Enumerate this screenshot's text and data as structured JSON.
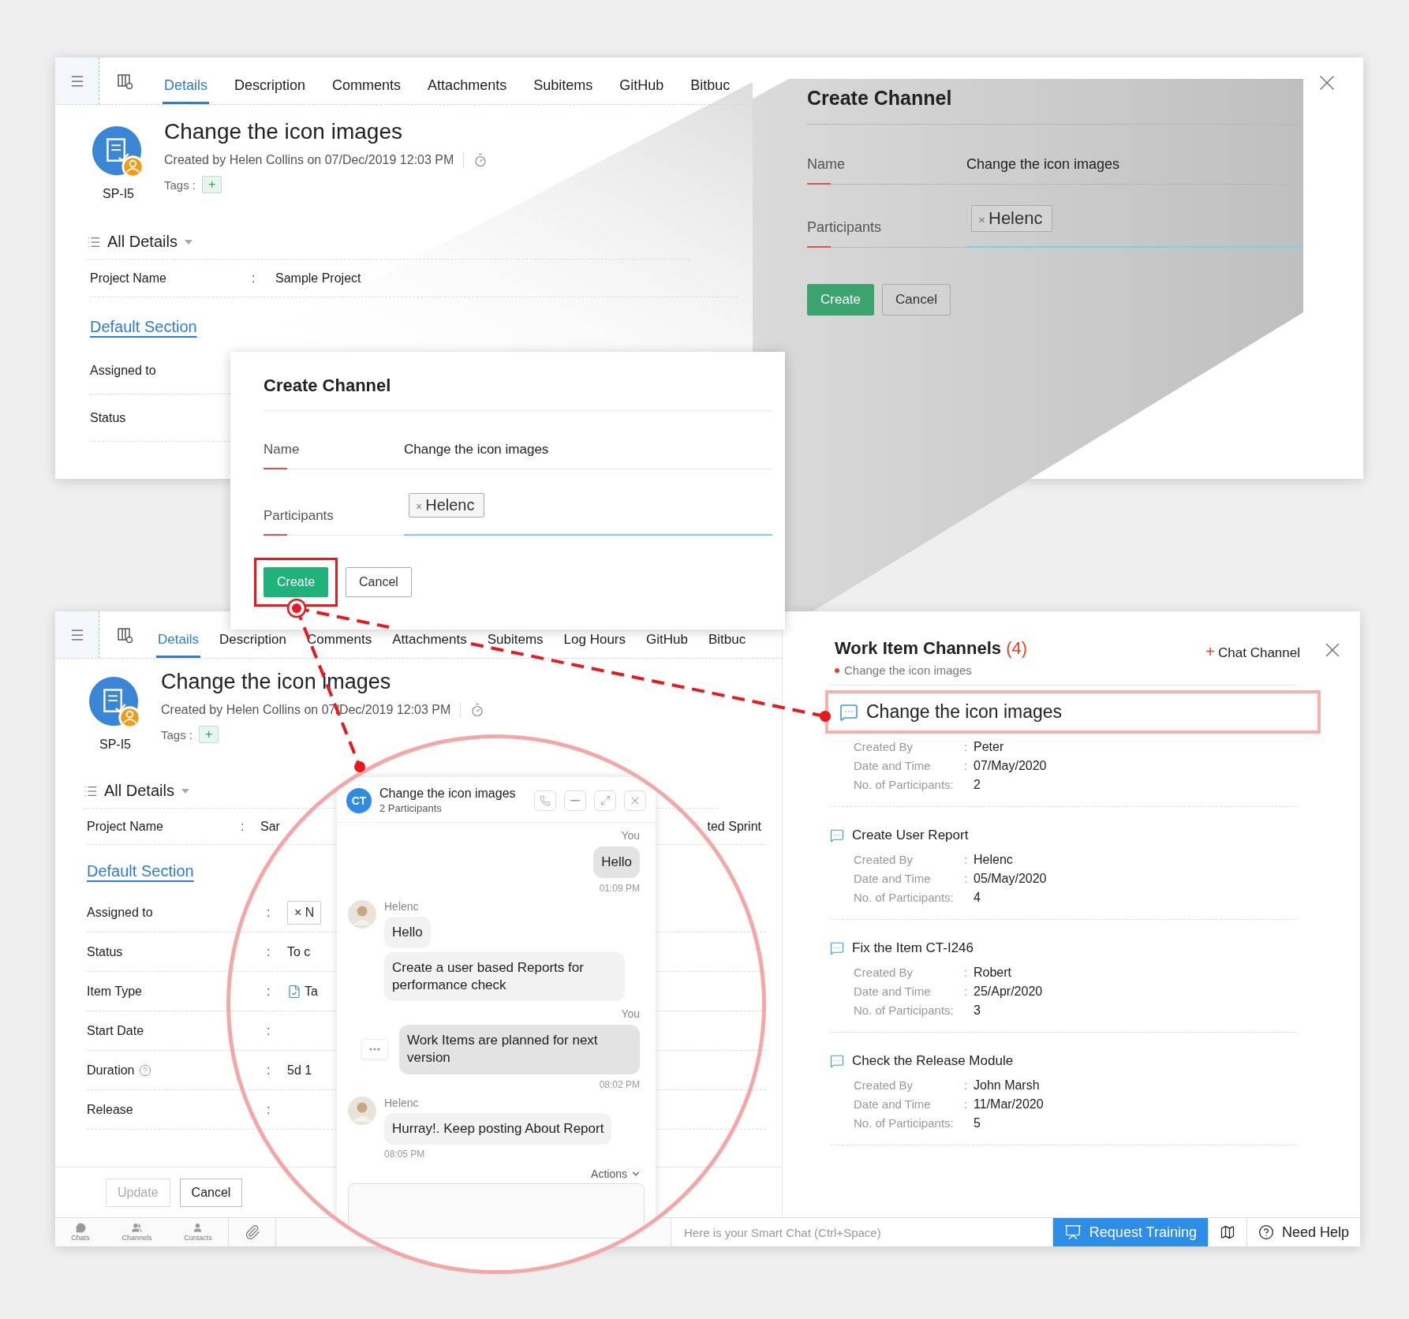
{
  "top_window": {
    "tabs": [
      {
        "label": "Details",
        "selected": true
      },
      {
        "label": "Description",
        "selected": false
      },
      {
        "label": "Comments",
        "selected": false
      },
      {
        "label": "Attachments",
        "selected": false
      },
      {
        "label": "Subitems",
        "selected": false
      },
      {
        "label": "GitHub",
        "selected": false
      },
      {
        "label": "Bitbuc",
        "selected": false
      }
    ],
    "item": {
      "title": "Change the icon images",
      "created": "Created by Helen Collins on 07/Dec/2019 12:03 PM",
      "id": "SP-I5",
      "tags_label": "Tags :",
      "add_tag": "+"
    },
    "section_header": "All Details",
    "rows": [
      {
        "label": "Project Name",
        "separator": ":",
        "value": "Sample Project"
      }
    ],
    "section_link": "Default Section",
    "section_rows": [
      {
        "label": "Assigned to"
      },
      {
        "label": "Status"
      }
    ]
  },
  "dialogs": [
    {
      "kind": "zoomed",
      "title": "Create Channel",
      "fields": [
        {
          "kind": "text",
          "label": "Name",
          "value": "Change the icon images"
        },
        {
          "kind": "chips",
          "label": "Participants",
          "chips": [
            {
              "remove": "×",
              "label": "Helenc"
            }
          ]
        }
      ],
      "buttons": [
        {
          "kind": "primary",
          "label": "Create"
        },
        {
          "kind": "secondary",
          "label": "Cancel"
        }
      ]
    },
    {
      "kind": "popup",
      "title": "Create Channel",
      "fields": [
        {
          "kind": "text",
          "label": "Name",
          "value": "Change the icon images"
        },
        {
          "kind": "chips",
          "label": "Participants",
          "chips": [
            {
              "remove": "×",
              "label": "Helenc"
            }
          ]
        }
      ],
      "buttons": [
        {
          "kind": "primary",
          "label": "Create",
          "highlighted": true
        },
        {
          "kind": "secondary",
          "label": "Cancel"
        }
      ]
    }
  ],
  "bottom_window": {
    "tabs": [
      {
        "label": "Details",
        "selected": true
      },
      {
        "label": "Description",
        "selected": false
      },
      {
        "label": "Comments",
        "selected": false
      },
      {
        "label": "Attachments",
        "selected": false
      },
      {
        "label": "Subitems",
        "selected": false
      },
      {
        "label": "Log Hours",
        "selected": false
      },
      {
        "label": "GitHub",
        "selected": false
      },
      {
        "label": "Bitbuc",
        "selected": false
      }
    ],
    "item": {
      "title": "Change the icon images",
      "created": "Created by Helen Collins on 07/Dec/2019 12:03 PM",
      "id": "SP-I5",
      "tags_label": "Tags :",
      "add_tag": "+"
    },
    "section_header": "All Details",
    "rows": [
      {
        "label": "Project Name",
        "separator": ":",
        "value": "Sar",
        "right": "ted Sprint"
      }
    ],
    "section_link": "Default Section",
    "section_rows": [
      {
        "label": "Assigned to",
        "separator": ":",
        "value": "× N",
        "kind": "chip"
      },
      {
        "label": "Status",
        "separator": ":",
        "value": "To c",
        "kind": "text"
      },
      {
        "label": "Item Type",
        "separator": ":",
        "value": "Ta",
        "kind": "task"
      },
      {
        "label": "Start Date",
        "separator": ":"
      },
      {
        "label": "Duration",
        "separator": ":",
        "value": "5d 1",
        "kind": "text",
        "help": true
      },
      {
        "label": "Release",
        "separator": ":"
      }
    ],
    "footer_buttons": [
      {
        "label": "Update",
        "disabled": true
      },
      {
        "label": "Cancel",
        "disabled": false
      }
    ]
  },
  "channels_panel": {
    "title": "Work Item Channels",
    "count": "(4)",
    "subtitle": "Change the icon images",
    "add_button": {
      "icon": "+",
      "label": "Chat Channel"
    },
    "channels": [
      {
        "title": "Change the icon images",
        "selected": true,
        "fields": [
          {
            "label": "Created By",
            "separator": ":",
            "value": "Peter"
          },
          {
            "label": "Date and Time",
            "separator": ":",
            "value": "07/May/2020"
          },
          {
            "label": "No. of Participants:",
            "value": "2"
          }
        ]
      },
      {
        "title": "Create User Report",
        "selected": false,
        "fields": [
          {
            "label": "Created By",
            "separator": ":",
            "value": "Helenc"
          },
          {
            "label": "Date and Time",
            "separator": ":",
            "value": "05/May/2020"
          },
          {
            "label": "No. of Participants:",
            "value": "4"
          }
        ]
      },
      {
        "title": "Fix the Item CT-I246",
        "selected": false,
        "fields": [
          {
            "label": "Created By",
            "separator": ":",
            "value": "Robert"
          },
          {
            "label": "Date and Time",
            "separator": ":",
            "value": "25/Apr/2020"
          },
          {
            "label": "No. of Participants:",
            "value": "3"
          }
        ]
      },
      {
        "title": "Check the Release Module",
        "selected": false,
        "fields": [
          {
            "label": "Created By",
            "separator": ":",
            "value": "John Marsh"
          },
          {
            "label": "Date and Time",
            "separator": ":",
            "value": "11/Mar/2020"
          },
          {
            "label": "No. of Participants:",
            "value": "5"
          }
        ]
      }
    ]
  },
  "bottom_bar": {
    "dock": [
      {
        "kind": "chats",
        "label": "Chats"
      },
      {
        "kind": "channels",
        "label": "Channels"
      },
      {
        "kind": "contacts",
        "label": "Contacts"
      }
    ],
    "smart_chat_placeholder": "Here is your Smart Chat (Ctrl+Space)",
    "buttons": [
      {
        "kind": "training",
        "label": "Request Training"
      },
      {
        "kind": "map"
      },
      {
        "kind": "help",
        "label": "Need Help"
      }
    ]
  },
  "chat": {
    "initials": "CT",
    "title": "Change the icon images",
    "subtitle": "2 Participants",
    "actions": "Actions",
    "messages": [
      {
        "kind": "sent",
        "sender": "You",
        "bubbles": [
          "Hello"
        ],
        "time": "01:09 PM"
      },
      {
        "kind": "received",
        "sender": "Helenc",
        "bubbles": [
          "Hello",
          "Create a user based Reports for performance check"
        ]
      },
      {
        "kind": "sent",
        "sender": "You",
        "bubbles": [
          "Work Items are planned for next version"
        ],
        "time": "08:02 PM",
        "more": true
      },
      {
        "kind": "received",
        "sender": "Helenc",
        "bubbles": [
          "Hurray!. Keep posting About Report"
        ],
        "time": "08:05 PM"
      }
    ]
  }
}
